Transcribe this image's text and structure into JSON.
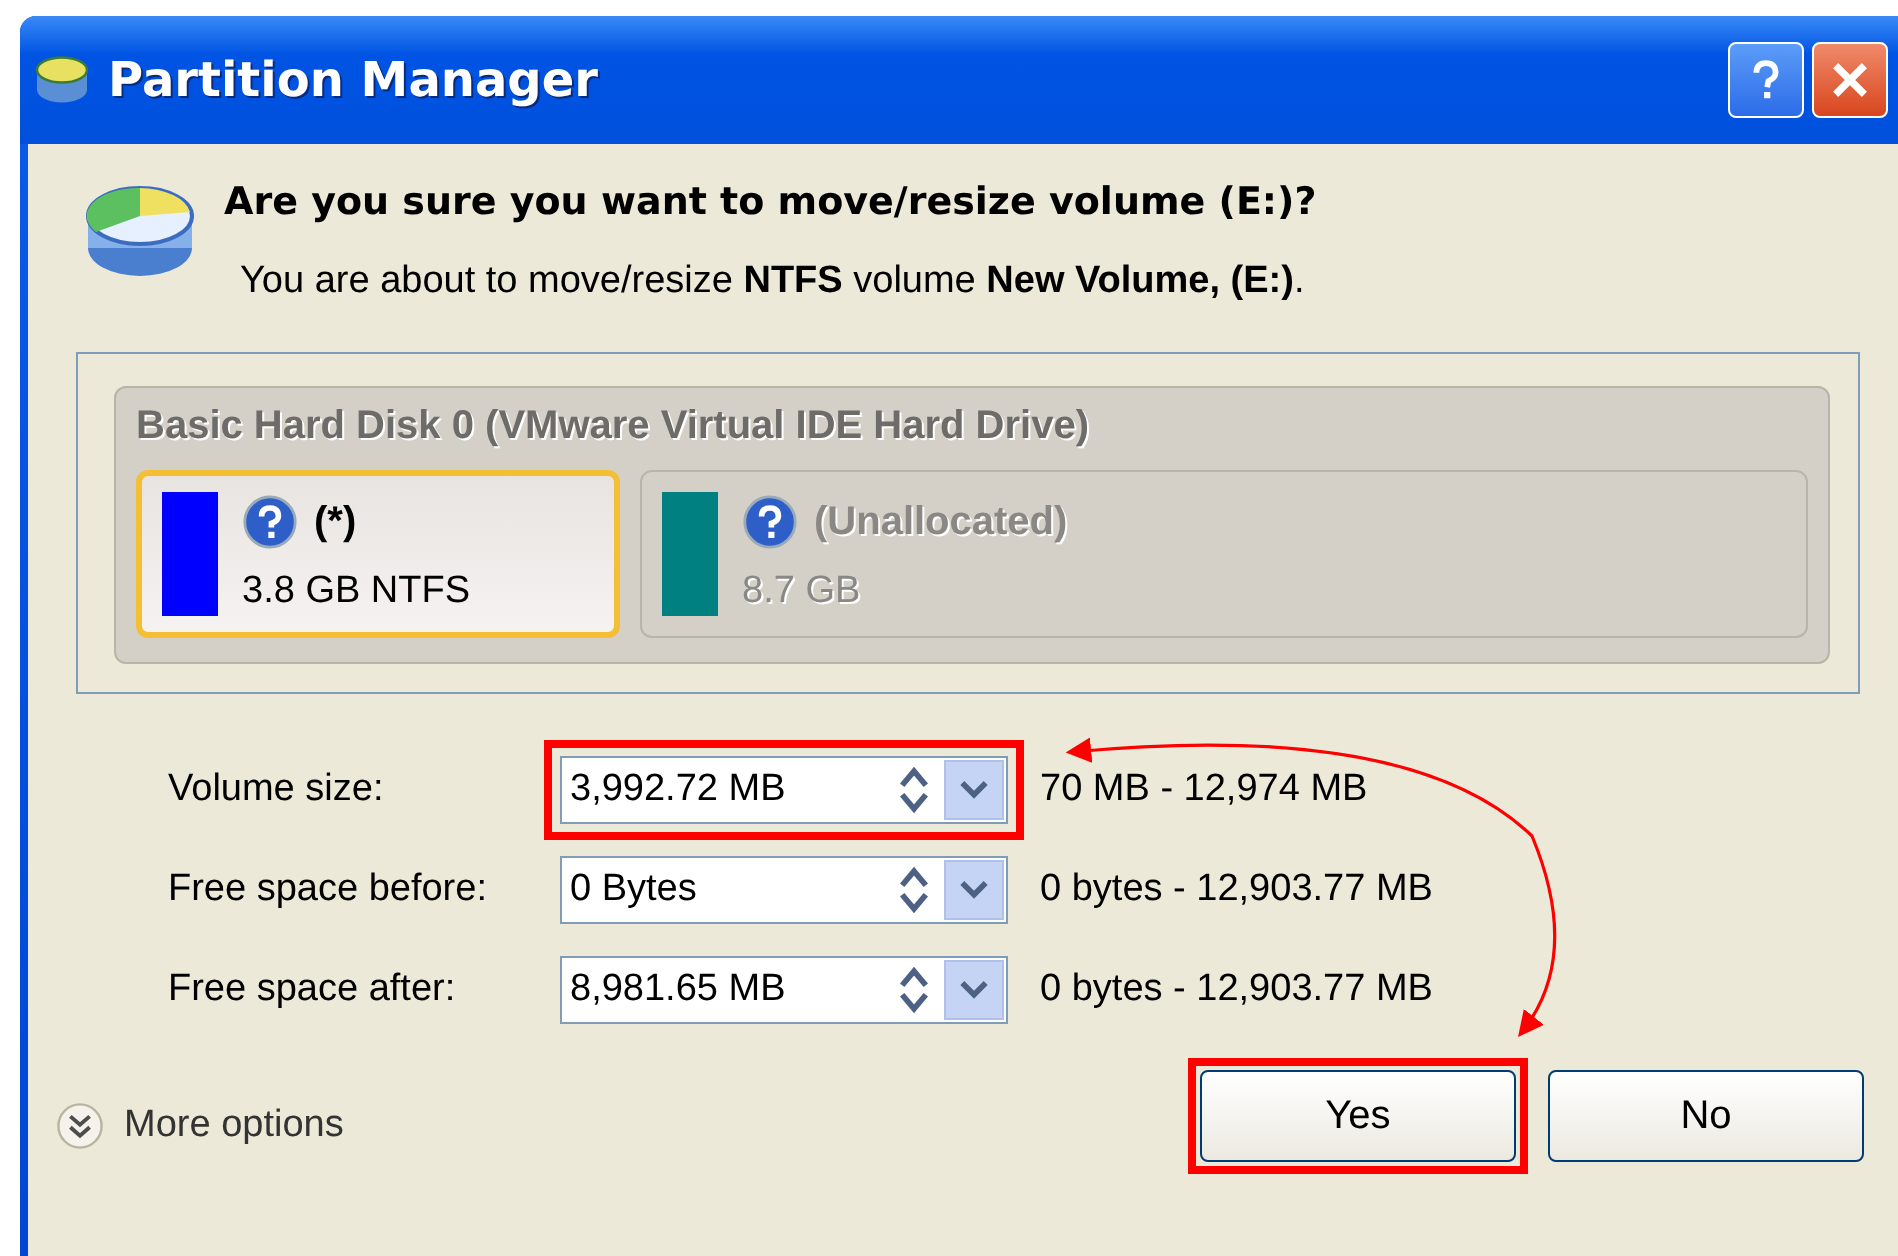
{
  "window": {
    "title": "Partition Manager"
  },
  "heading": "Are you sure you want to move/resize volume (E:)?",
  "message": "You are about to move/resize **NTFS** volume **New Volume, (E:)**.",
  "disk": {
    "title": "Basic Hard Disk 0 (VMware Virtual IDE Hard Drive)",
    "partitions": [
      {
        "name": "(*)",
        "size": "3.8 GB NTFS",
        "color": "#0000ff",
        "selected": true
      },
      {
        "name": "(Unallocated)",
        "size": "8.7 GB",
        "color": "#008080",
        "selected": false
      }
    ]
  },
  "fields": [
    {
      "label": "Volume size:",
      "value": "3,992.72 MB",
      "range": "70 MB - 12,974 MB",
      "highlighted": true
    },
    {
      "label": "Free space before:",
      "value": "0 Bytes",
      "range": "0 bytes - 12,903.77 MB",
      "highlighted": false
    },
    {
      "label": "Free space after:",
      "value": "8,981.65 MB",
      "range": "0 bytes - 12,903.77 MB",
      "highlighted": false
    }
  ],
  "more_options": "More options",
  "buttons": [
    {
      "label": "Yes",
      "highlighted": true
    },
    {
      "label": "No",
      "highlighted": false
    }
  ]
}
